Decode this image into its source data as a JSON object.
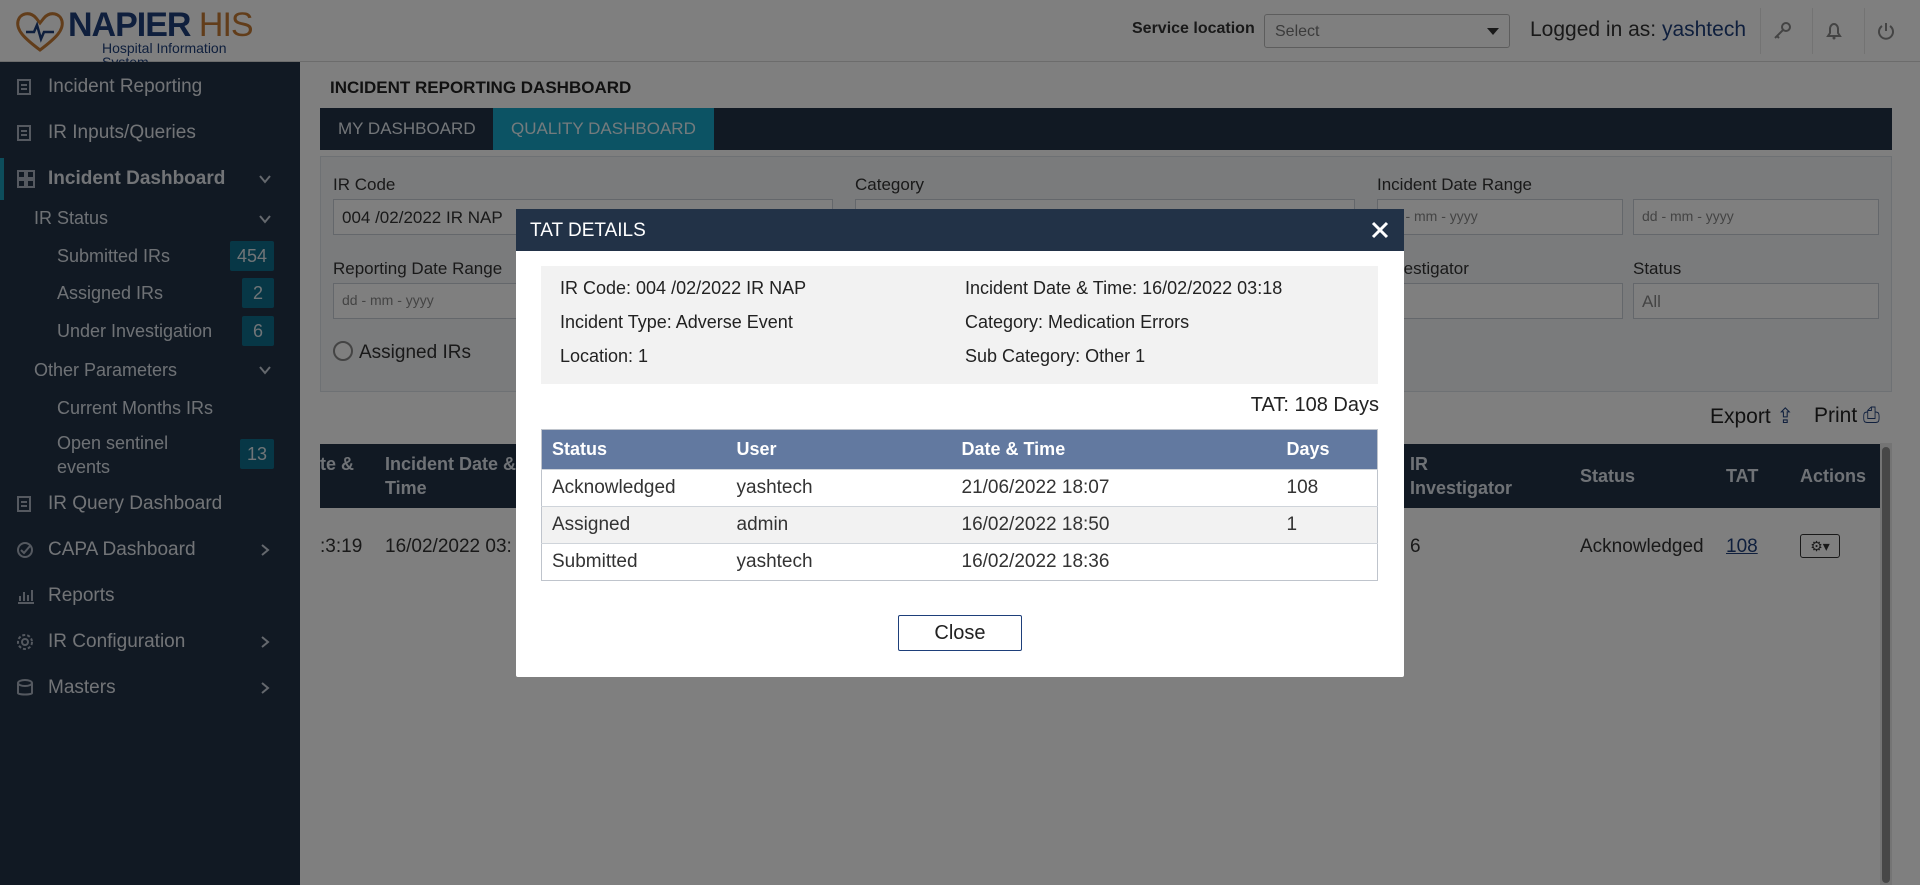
{
  "header": {
    "brand_main": "NAPIER",
    "brand_accent": "HIS",
    "brand_sub": "Hospital Information System",
    "service_location_label": "Service location",
    "service_location_value": "Select",
    "logged_in_label": "Logged in as:",
    "logged_in_user": "yashtech",
    "icons": [
      "key-icon",
      "bell-icon",
      "power-icon"
    ]
  },
  "sidebar": {
    "items": [
      {
        "label": "Incident Reporting",
        "icon": "report-icon"
      },
      {
        "label": "IR Inputs/Queries",
        "icon": "report-icon"
      },
      {
        "label": "Incident Dashboard",
        "icon": "dashboard-icon"
      },
      {
        "label": "IR Query Dashboard",
        "icon": "report-icon"
      },
      {
        "label": "CAPA Dashboard",
        "icon": "check-circle-icon"
      },
      {
        "label": "Reports",
        "icon": "chart-icon"
      },
      {
        "label": "IR Configuration",
        "icon": "gear-icon"
      },
      {
        "label": "Masters",
        "icon": "database-icon"
      }
    ],
    "ir_status_label": "IR Status",
    "submitted_label": "Submitted IRs",
    "submitted_count": "454",
    "assigned_label": "Assigned IRs",
    "assigned_count": "2",
    "under_investigation_label": "Under Investigation",
    "under_investigation_count": "6",
    "other_params_label": "Other Parameters",
    "current_months_label": "Current Months IRs",
    "open_sentinel_label_1": "Open sentinel",
    "open_sentinel_label_2": "events",
    "open_sentinel_count": "13"
  },
  "main": {
    "title": "INCIDENT REPORTING DASHBOARD",
    "tabs": [
      {
        "label": "MY DASHBOARD"
      },
      {
        "label": "QUALITY DASHBOARD"
      }
    ],
    "filters": {
      "ir_code_label": "IR Code",
      "ir_code_value": "004 /02/2022 IR NAP",
      "category_label": "Category",
      "incident_date_range_label": "Incident Date Range",
      "date_placeholder": "dd - mm - yyyy",
      "reporting_date_range_label": "Reporting Date Range",
      "investigator_label": "Investigator",
      "status_label": "Status",
      "status_value": "All",
      "radio_assigned": "Assigned IRs"
    },
    "export_label": "Export",
    "print_label": "Print",
    "grid": {
      "headers": [
        "te &",
        "Incident Date &",
        "Time",
        "IR",
        "Investigator",
        "Status",
        "TAT",
        "Actions"
      ],
      "row": {
        "time_fragment": ":3:19",
        "incident_date": "16/02/2022 03:",
        "investigator": "6",
        "status": "Acknowledged",
        "tat": "108"
      }
    }
  },
  "modal": {
    "title": "TAT DETAILS",
    "ir_code": "IR Code: 004 /02/2022 IR NAP",
    "incident_type": "Incident Type: Adverse Event",
    "location": "Location: 1",
    "incident_datetime": "Incident Date & Time: 16/02/2022 03:18",
    "category": "Category: Medication Errors",
    "sub_category": "Sub Category: Other 1",
    "tat": "TAT: 108 Days",
    "columns": [
      "Status",
      "User",
      "Date & Time",
      "Days"
    ],
    "rows": [
      {
        "status": "Acknowledged",
        "user": "yashtech",
        "datetime": "21/06/2022 18:07",
        "days": "108"
      },
      {
        "status": "Assigned",
        "user": "admin",
        "datetime": "16/02/2022 18:50",
        "days": "1"
      },
      {
        "status": "Submitted",
        "user": "yashtech",
        "datetime": "16/02/2022 18:36",
        "days": ""
      }
    ],
    "close_label": "Close"
  },
  "colors": {
    "navy": "#223247",
    "accent_teal": "#18a6c8",
    "table_header": "#6279a0",
    "brand_blue": "#1e3f7a",
    "brand_orange": "#c47a35"
  }
}
